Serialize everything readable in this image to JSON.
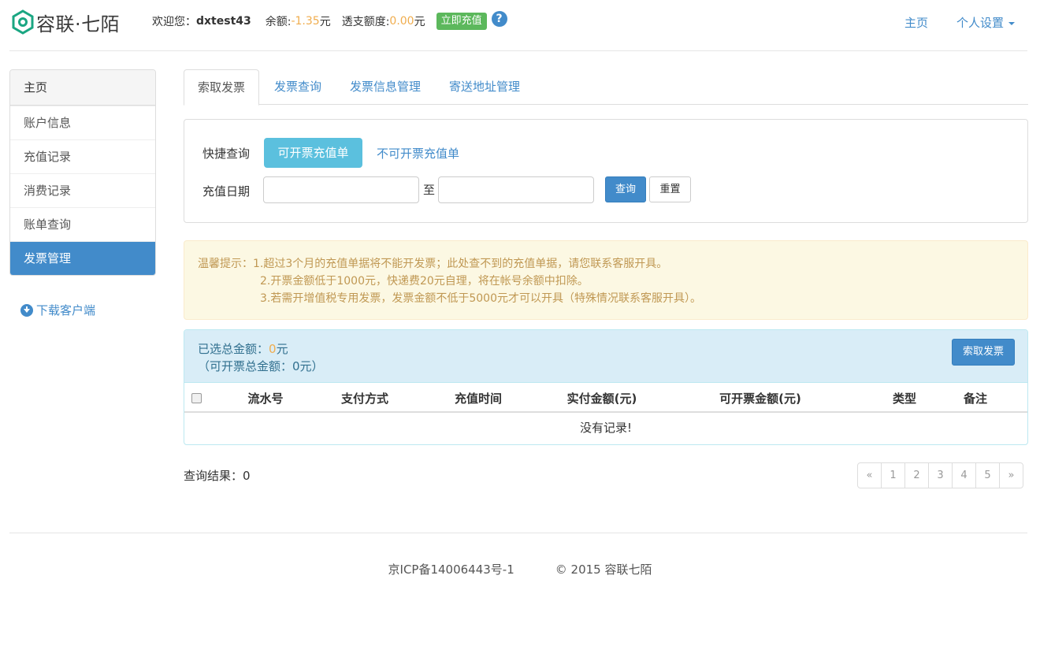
{
  "header": {
    "logo_text": "容联·七陌",
    "welcome_label": "欢迎您：",
    "username": "dxtest43",
    "balance_label": "余额:",
    "balance_value": "-1.35",
    "balance_unit": "元",
    "overdraft_label": "透支额度:",
    "overdraft_value": "0.00",
    "overdraft_unit": "元",
    "recharge_button": "立即充值",
    "help_icon": "?",
    "nav_home": "主页",
    "nav_settings": "个人设置"
  },
  "sidebar": {
    "heading": "主页",
    "items": [
      {
        "label": "账户信息"
      },
      {
        "label": "充值记录"
      },
      {
        "label": "消费记录"
      },
      {
        "label": "账单查询"
      },
      {
        "label": "发票管理"
      }
    ],
    "download_label": "下载客户端"
  },
  "tabs": [
    {
      "label": "索取发票"
    },
    {
      "label": "发票查询"
    },
    {
      "label": "发票信息管理"
    },
    {
      "label": "寄送地址管理"
    }
  ],
  "search": {
    "quick_label": "快捷查询",
    "quick_active": "可开票充值单",
    "quick_other": "不可开票充值单",
    "date_label": "充值日期",
    "date_separator": "至",
    "start_value": "",
    "end_value": "",
    "query_button": "查询",
    "reset_button": "重置"
  },
  "notice": {
    "line1": "温馨提示：1.超过3个月的充值单据将不能开发票；此处查不到的充值单据，请您联系客服开具。",
    "line2": "2.开票金额低于1000元，快递费20元自理，将在帐号余额中扣除。",
    "line3": "3.若需开增值税专用发票，发票金额不低于5000元才可以开具（特殊情况联系客服开具）。"
  },
  "summary": {
    "selected_label": "已选总金额：",
    "selected_value": "0",
    "selected_unit": "元",
    "available_text": "（可开票总金额：0元）",
    "get_invoice_button": "索取发票"
  },
  "table": {
    "columns": [
      "流水号",
      "支付方式",
      "充值时间",
      "实付金额(元)",
      "可开票金额(元)",
      "类型",
      "备注"
    ],
    "empty_text": "没有记录!"
  },
  "result": {
    "label": "查询结果：",
    "count": "0"
  },
  "pagination": [
    "«",
    "1",
    "2",
    "3",
    "4",
    "5",
    "»"
  ],
  "footer": {
    "icp": "京ICP备14006443号-1",
    "copyright": "© 2015 容联七陌"
  },
  "colors": {
    "primary": "#428bca",
    "info": "#5bc0de",
    "success": "#5cb85c",
    "warning": "#f0ad4e"
  }
}
